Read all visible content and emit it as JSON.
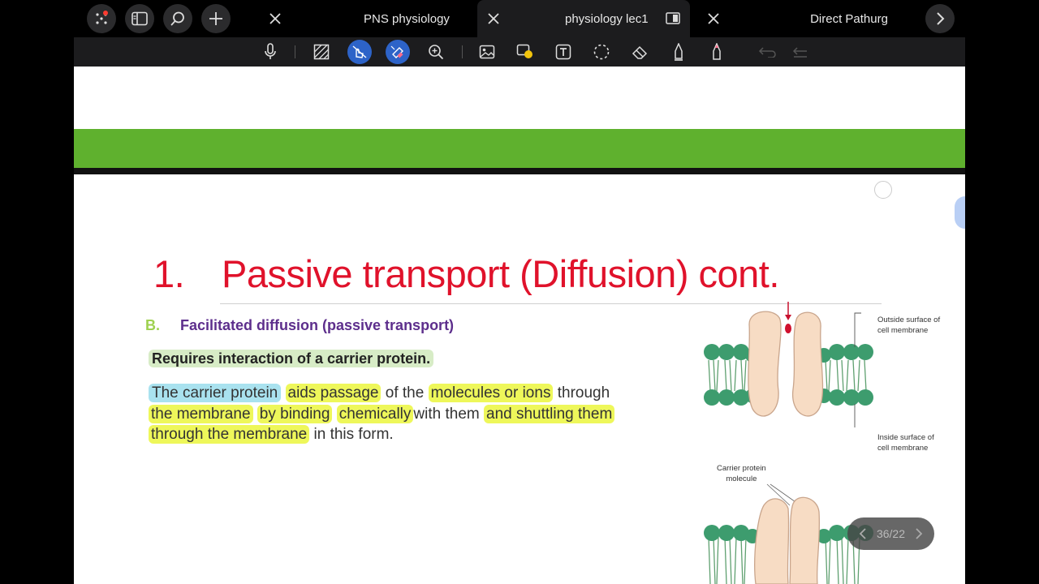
{
  "tabs": [
    {
      "label": "PNS physiology",
      "active": false
    },
    {
      "label": "physiology lec1",
      "active": true
    },
    {
      "label": "Direct Pathurg",
      "active": false
    }
  ],
  "toolbar": {
    "tools": [
      "microphone-icon",
      "hatch-select-icon",
      "touch-pen-icon",
      "highlighter-icon",
      "zoom-icon",
      "image-icon",
      "shape-icon",
      "text-box-icon",
      "lasso-icon",
      "eraser-icon",
      "pen-icon",
      "pencil-icon",
      "undo-icon",
      "redo-icon"
    ],
    "active_tools": [
      "touch-pen-icon",
      "highlighter-icon"
    ],
    "accent_color": "#2d63c8"
  },
  "slide": {
    "title_number": "1.",
    "title_text": "Passive transport (Diffusion) cont.",
    "section_letter": "B.",
    "section_title": "Facilitated diffusion (passive transport)",
    "requirement": "Requires interaction of a carrier protein.",
    "paragraph": {
      "line1": {
        "a": "The carrier protein",
        "b": "aids passage",
        "c": "of the",
        "d": "molecules or ions",
        "e": "through"
      },
      "line2": {
        "a": "the membrane",
        "b": "by binding",
        "c": "chemically",
        "d": "with them",
        "e": "and shuttling them"
      },
      "line3": {
        "a": "through the membrane",
        "b": "in this form."
      }
    },
    "diagram_labels": {
      "outside": "Outside surface of\ncell membrane",
      "inside": "Inside surface of\ncell membrane",
      "carrier": "Carrier protein\nmolecule"
    },
    "colors": {
      "title": "#e0122b",
      "band": "#5fb12e",
      "subtitle": "#5d2e8c",
      "section_letter": "#9ed14f"
    }
  },
  "pager": {
    "label": "36/22"
  }
}
